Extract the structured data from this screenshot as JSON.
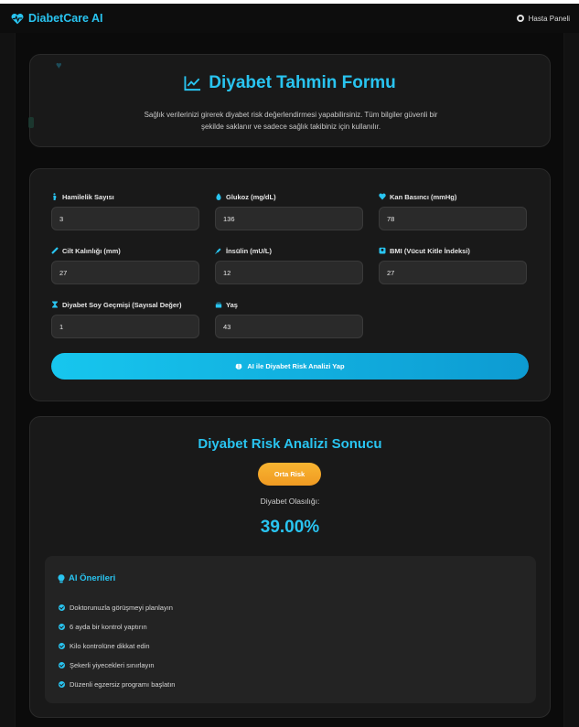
{
  "app": {
    "name": "DiabetCare AI",
    "user_panel_label": "Hasta Paneli"
  },
  "form": {
    "title": "Diyabet Tahmin Formu",
    "description": "Sağlık verilerinizi girerek diyabet risk değerlendirmesi yapabilirsiniz. Tüm bilgiler güvenli bir şekilde saklanır ve sadece sağlık takibiniz için kullanılır.",
    "fields": [
      {
        "label": "Hamilelik Sayısı",
        "value": "3",
        "icon": "person-pregnant-icon"
      },
      {
        "label": "Glukoz (mg/dL)",
        "value": "136",
        "icon": "droplet-icon"
      },
      {
        "label": "Kan Basıncı (mmHg)",
        "value": "78",
        "icon": "heart-pulse-icon"
      },
      {
        "label": "Cilt Kalınlığı (mm)",
        "value": "27",
        "icon": "ruler-icon"
      },
      {
        "label": "İnsülin (mU/L)",
        "value": "12",
        "icon": "syringe-icon"
      },
      {
        "label": "BMI (Vücut Kitle İndeksi)",
        "value": "27",
        "icon": "weight-scale-icon"
      },
      {
        "label": "Diyabet Soy Geçmişi (Sayısal Değer)",
        "value": "1",
        "icon": "hourglass-icon"
      },
      {
        "label": "Yaş",
        "value": "43",
        "icon": "birthday-cake-icon"
      }
    ],
    "submit_label": "AI ile Diyabet Risk Analizi Yap"
  },
  "result": {
    "title": "Diyabet Risk Analizi Sonucu",
    "risk_level": "Orta Risk",
    "probability_label": "Diyabet Olasılığı:",
    "probability_value": "39.00%",
    "recommendations_title": "AI Önerileri",
    "recommendations": [
      "Doktorunuzla görüşmeyi planlayın",
      "6 ayda bir kontrol yaptırın",
      "Kilo kontrolüne dikkat edin",
      "Şekerli yiyecekleri sınırlayın",
      "Düzenli egzersiz programı başlatın"
    ]
  },
  "colors": {
    "accent": "#29c4f0",
    "risk_badge": "#f5a623",
    "background": "#121212",
    "card": "#191919"
  }
}
